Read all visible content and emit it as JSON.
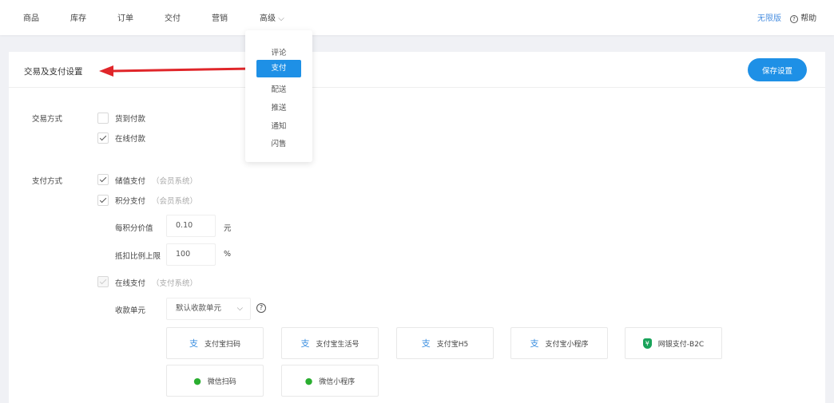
{
  "nav": {
    "items": [
      "商品",
      "库存",
      "订单",
      "交付",
      "营销",
      "高级"
    ],
    "edition": "无限版",
    "help": "帮助"
  },
  "dropdown": {
    "items": [
      "评论",
      "支付",
      "配送",
      "推送",
      "通知",
      "闪售"
    ],
    "active": "支付"
  },
  "card": {
    "title": "交易及支付设置",
    "save": "保存设置"
  },
  "trade": {
    "label": "交易方式",
    "options": [
      {
        "label": "货到付款",
        "checked": false
      },
      {
        "label": "在线付款",
        "checked": true
      }
    ]
  },
  "pay": {
    "label": "支付方式",
    "stored": {
      "label": "储值支付",
      "hint": "（会员系统）"
    },
    "points": {
      "label": "积分支付",
      "hint": "（会员系统）"
    },
    "point_value": {
      "label": "每积分价值",
      "value": "0.10",
      "unit": "元"
    },
    "deduct_limit": {
      "label": "抵扣比例上限",
      "value": "100",
      "unit": "%"
    },
    "online": {
      "label": "在线支付",
      "hint": "（支付系统）"
    },
    "unit": {
      "label": "收款单元",
      "value": "默认收款单元"
    },
    "methods": [
      "支付宝扫码",
      "支付宝生活号",
      "支付宝H5",
      "支付宝小程序",
      "网银支付-B2C",
      "微信扫码",
      "微信小程序"
    ]
  },
  "colors": {
    "accent": "#1e90e6",
    "annotation": "#e0262a",
    "wechat": "#2aae30",
    "unionpay": "#19a35a"
  }
}
